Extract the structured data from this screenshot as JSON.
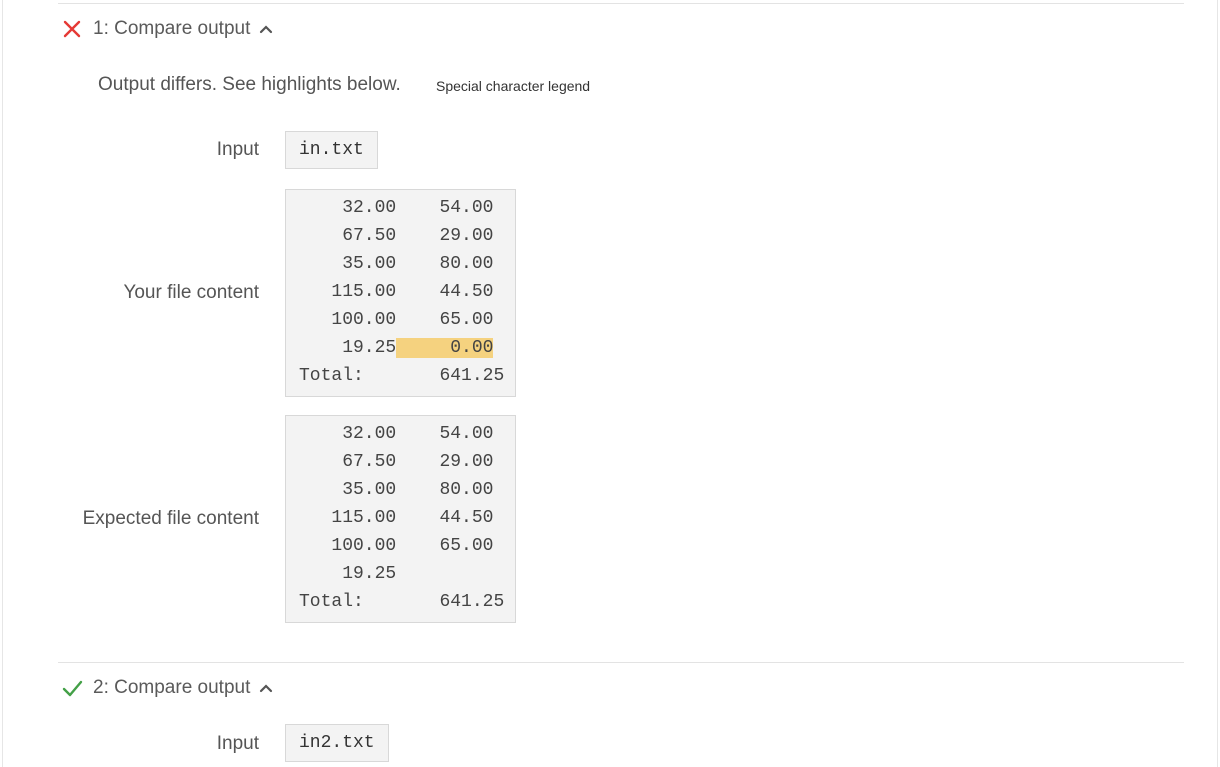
{
  "tests": [
    {
      "title": "1: Compare output",
      "status": "fail",
      "status_icon": "x-icon",
      "status_color": "#e53935",
      "message": "Output differs. See highlights below.",
      "legend_link": "Special character legend",
      "input_label": "Input",
      "input_file": "in.txt",
      "your_label": "Your file content",
      "your_lines": [
        {
          "a": "    32.00",
          "gap": "    ",
          "b": "54.00"
        },
        {
          "a": "    67.50",
          "gap": "    ",
          "b": "29.00"
        },
        {
          "a": "    35.00",
          "gap": "    ",
          "b": "80.00"
        },
        {
          "a": "   115.00",
          "gap": "    ",
          "b": "44.50"
        },
        {
          "a": "   100.00",
          "gap": "    ",
          "b": "65.00"
        },
        {
          "a": "    19.25",
          "gap": "     ",
          "b": "0.00"
        },
        {
          "a": "Total:   ",
          "gap": "    ",
          "b": "641.25"
        }
      ],
      "highlight_line_index": 5,
      "expected_label": "Expected file content",
      "expected_lines": [
        {
          "a": "    32.00",
          "gap": "    ",
          "b": "54.00"
        },
        {
          "a": "    67.50",
          "gap": "    ",
          "b": "29.00"
        },
        {
          "a": "    35.00",
          "gap": "    ",
          "b": "80.00"
        },
        {
          "a": "   115.00",
          "gap": "    ",
          "b": "44.50"
        },
        {
          "a": "   100.00",
          "gap": "    ",
          "b": "65.00"
        },
        {
          "a": "    19.25",
          "gap": "",
          "b": ""
        },
        {
          "a": "Total:   ",
          "gap": "    ",
          "b": "641.25"
        }
      ]
    },
    {
      "title": "2: Compare output",
      "status": "pass",
      "status_icon": "check-icon",
      "status_color": "#43a047",
      "input_label": "Input",
      "input_file": "in2.txt"
    }
  ],
  "accent_highlight": "#f5d27f"
}
